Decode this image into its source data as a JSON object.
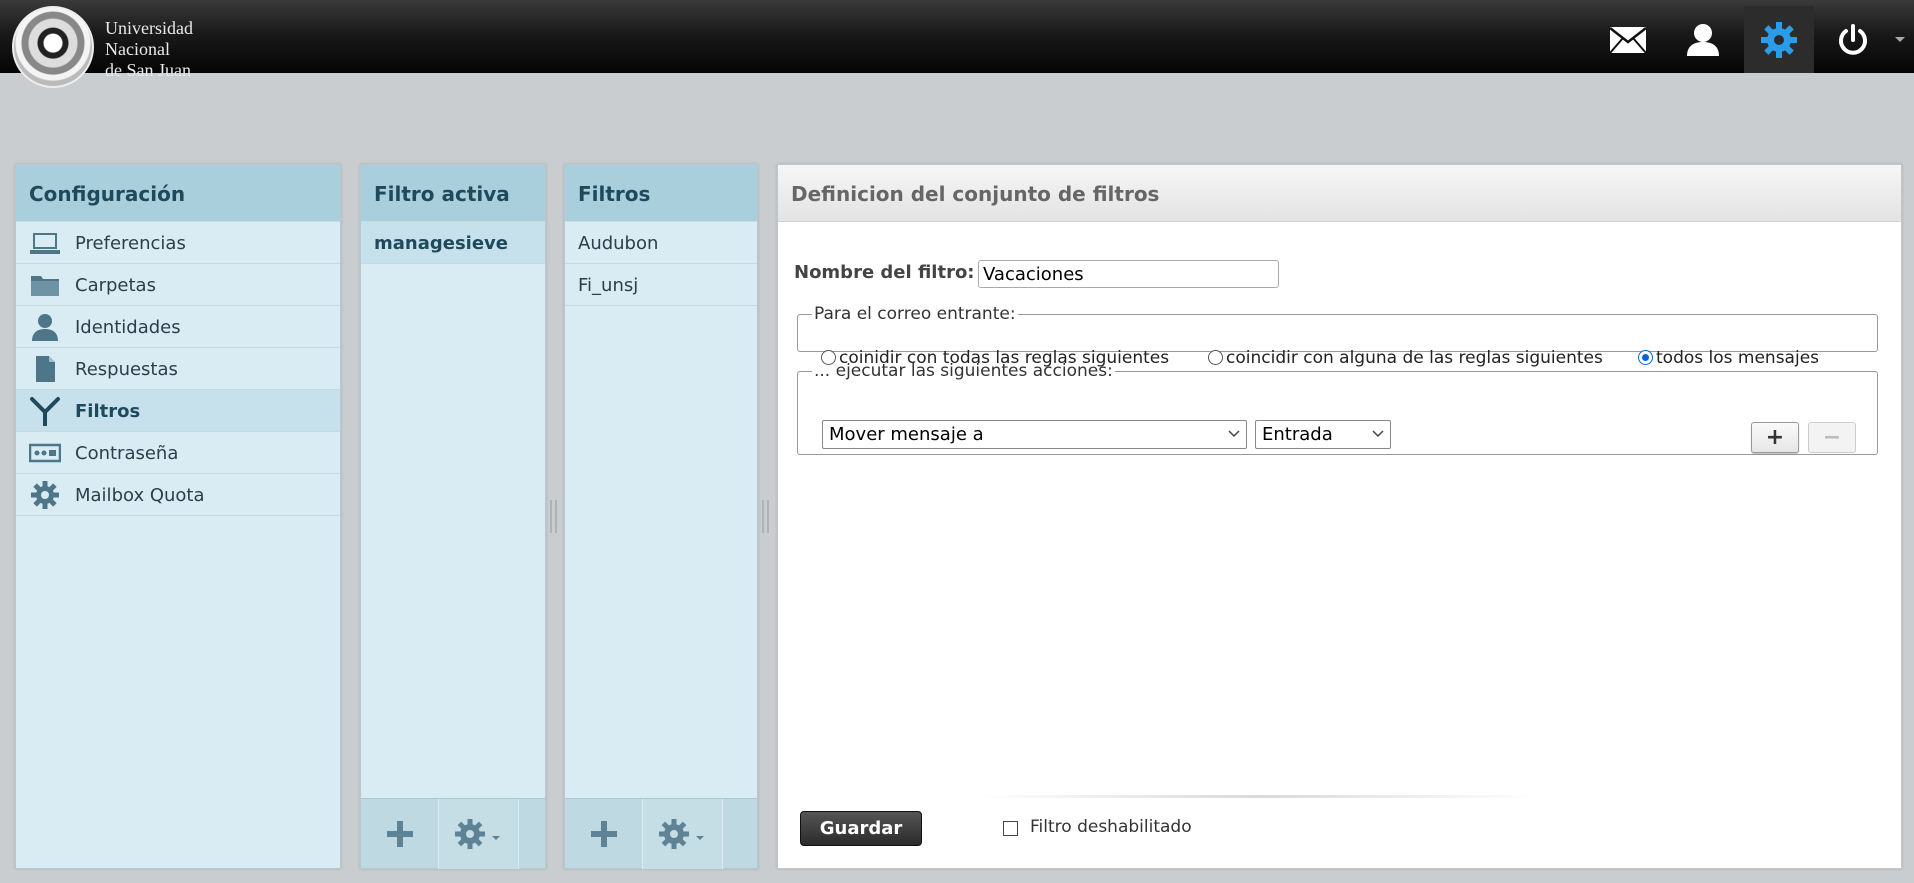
{
  "header": {
    "logo_lines": [
      "Universidad",
      "Nacional",
      "de San Juan"
    ],
    "buttons": [
      {
        "name": "mail",
        "icon": "mail-icon"
      },
      {
        "name": "contacts",
        "icon": "user-icon"
      },
      {
        "name": "settings",
        "icon": "gear-icon",
        "active": true
      },
      {
        "name": "logout",
        "icon": "power-icon"
      }
    ],
    "colors": {
      "active_icon": "#2a9ce8",
      "icon": "#ffffff"
    }
  },
  "config_panel": {
    "title": "Configuración",
    "items": [
      {
        "label": "Preferencias",
        "icon": "laptop-icon"
      },
      {
        "label": "Carpetas",
        "icon": "folder-icon"
      },
      {
        "label": "Identidades",
        "icon": "person-icon"
      },
      {
        "label": "Respuestas",
        "icon": "document-icon"
      },
      {
        "label": "Filtros",
        "icon": "filter-icon",
        "selected": true
      },
      {
        "label": "Contraseña",
        "icon": "password-icon"
      },
      {
        "label": "Mailbox Quota",
        "icon": "gear-icon"
      }
    ]
  },
  "active_panel": {
    "title": "Filtro activa",
    "items": [
      {
        "label": "managesieve",
        "selected": true
      }
    ]
  },
  "filters_panel": {
    "title": "Filtros",
    "items": [
      {
        "label": "Audubon"
      },
      {
        "label": "Fi_unsj"
      }
    ]
  },
  "main": {
    "title": "Definicion del conjunto de filtros",
    "name_label": "Nombre del filtro:",
    "name_value": "Vacaciones",
    "incoming_legend": "Para el correo entrante:",
    "radios": [
      {
        "label": "coinidir con todas las reglas siguientes",
        "checked": false
      },
      {
        "label": "coincidir con alguna de las reglas siguientes",
        "checked": false
      },
      {
        "label": "todos los mensajes",
        "checked": true
      }
    ],
    "actions_legend": "... ejecutar las siguientes acciones:",
    "action_select": "Mover mensaje a",
    "folder_select": "Entrada",
    "add_label": "+",
    "remove_label": "−",
    "save_label": "Guardar",
    "disabled_label": "Filtro deshabilitado"
  }
}
